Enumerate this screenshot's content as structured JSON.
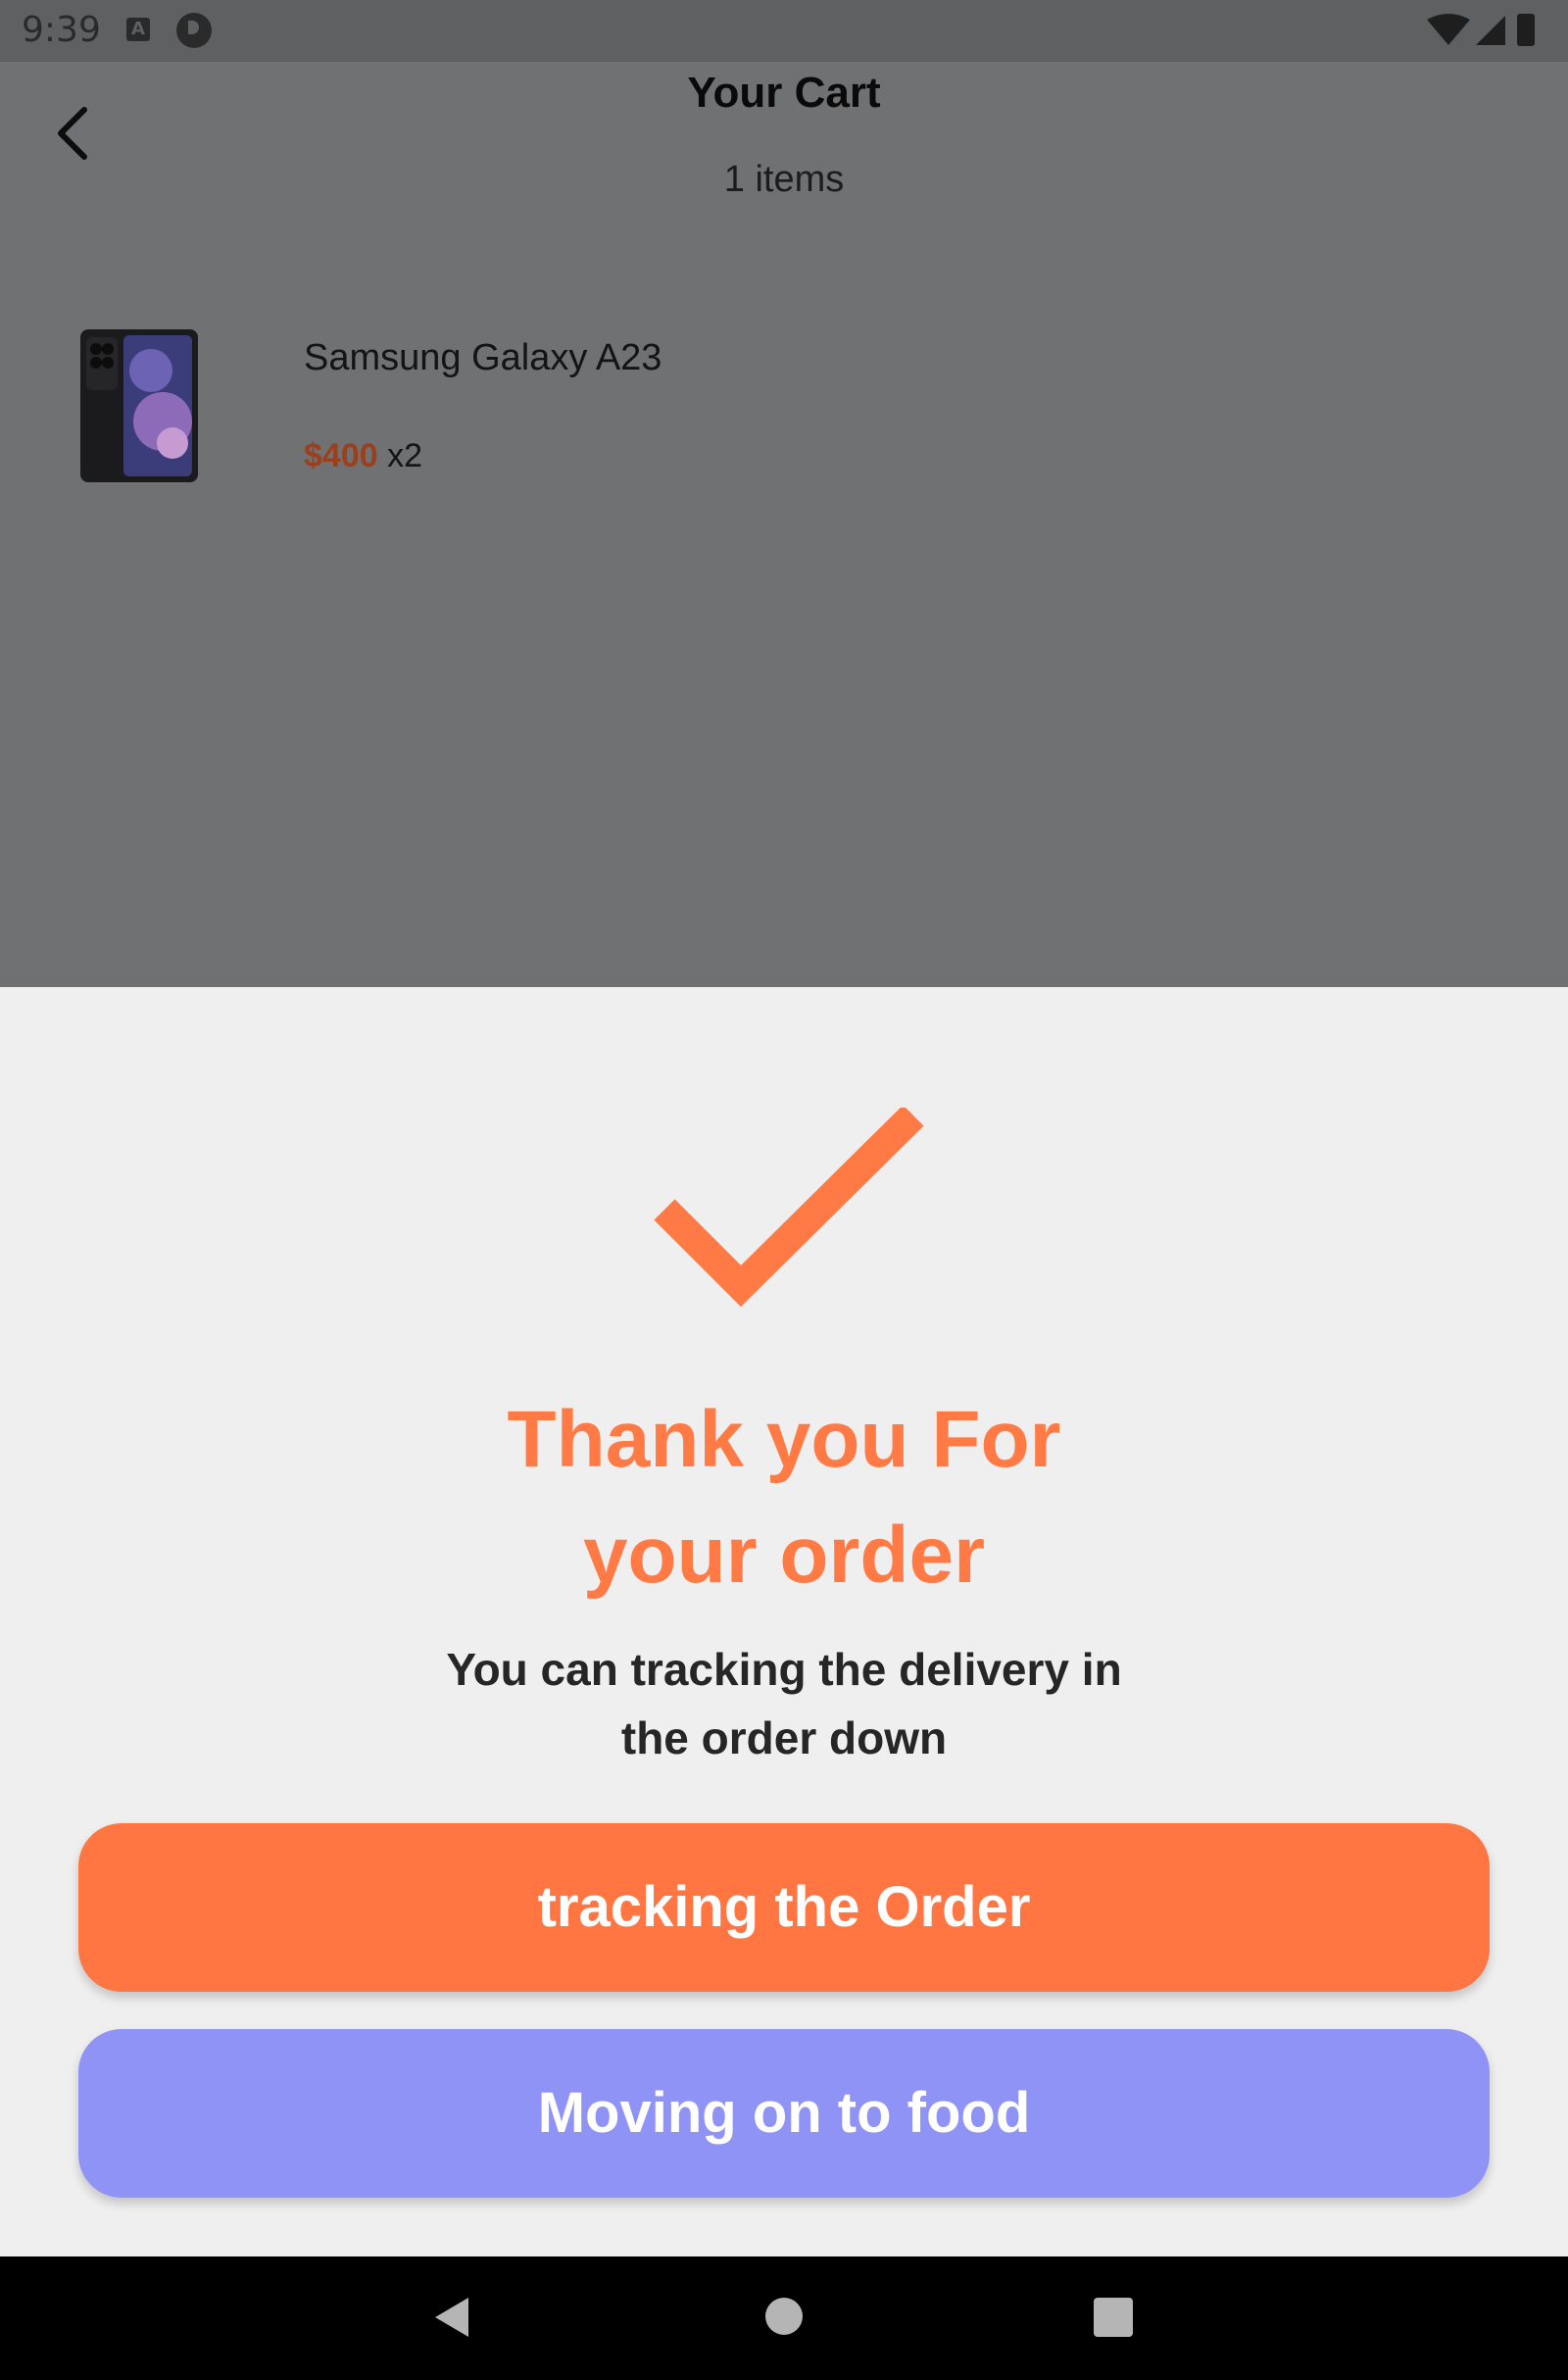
{
  "status_bar": {
    "time": "9:39",
    "icons": [
      "a-badge-icon",
      "p-circle-icon",
      "wifi-icon",
      "signal-icon",
      "battery-icon"
    ]
  },
  "cart": {
    "title": "Your Cart",
    "count": "1 items",
    "item": {
      "name": "Samsung Galaxy A23",
      "price": "$400",
      "quantity": "x2"
    }
  },
  "dialog": {
    "title_line1": "Thank you For",
    "title_line2": "your order",
    "subtitle_line1": "You can tracking the delivery in",
    "subtitle_line2": "the order down",
    "track_button": "tracking the Order",
    "food_button": "Moving on to food"
  },
  "colors": {
    "accent": "#ff7643",
    "secondary": "#8f93f6",
    "price": "#9b3f1c"
  }
}
